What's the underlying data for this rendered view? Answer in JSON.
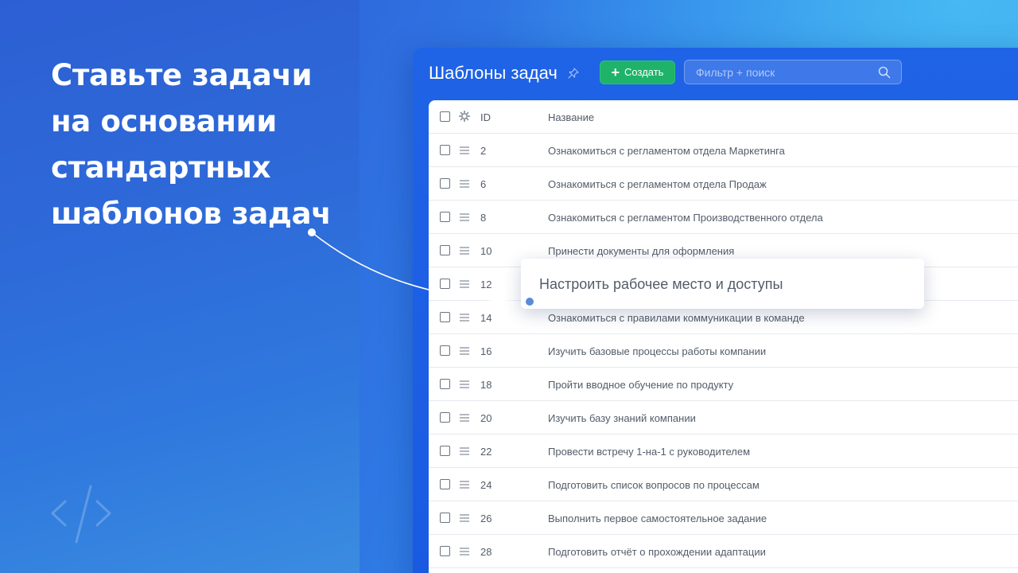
{
  "hero": {
    "lines": [
      "Ставьте задачи",
      "на основании",
      "стандартных",
      "шаблонов задач"
    ]
  },
  "panel": {
    "title": "Шаблоны задач",
    "create_label": "Создать",
    "search_placeholder": "Фильтр + поиск",
    "columns": {
      "id": "ID",
      "name": "Название"
    },
    "rows": [
      {
        "id": "2",
        "name": "Ознакомиться с регламентом отдела Маркетинга"
      },
      {
        "id": "6",
        "name": "Ознакомиться с регламентом отдела Продаж"
      },
      {
        "id": "8",
        "name": "Ознакомиться с регламентом Производственного отдела"
      },
      {
        "id": "10",
        "name": "Принести документы для оформления"
      },
      {
        "id": "12",
        "name": ""
      },
      {
        "id": "14",
        "name": "Ознакомиться с правилами коммуникации в команде"
      },
      {
        "id": "16",
        "name": "Изучить базовые процессы работы компании"
      },
      {
        "id": "18",
        "name": "Пройти вводное обучение по продукту"
      },
      {
        "id": "20",
        "name": "Изучить базу знаний компании"
      },
      {
        "id": "22",
        "name": "Провести встречу 1-на-1 с руководителем"
      },
      {
        "id": "24",
        "name": "Подготовить список вопросов по процессам"
      },
      {
        "id": "26",
        "name": "Выполнить первое самостоятельное задание"
      },
      {
        "id": "28",
        "name": "Подготовить отчёт о прохождении адаптации"
      }
    ]
  },
  "popup": {
    "text": "Настроить рабочее место и доступы"
  },
  "colors": {
    "accent_green": "#1fb36a",
    "panel_blue": "#1f63e6",
    "text_gray": "#535c69"
  }
}
